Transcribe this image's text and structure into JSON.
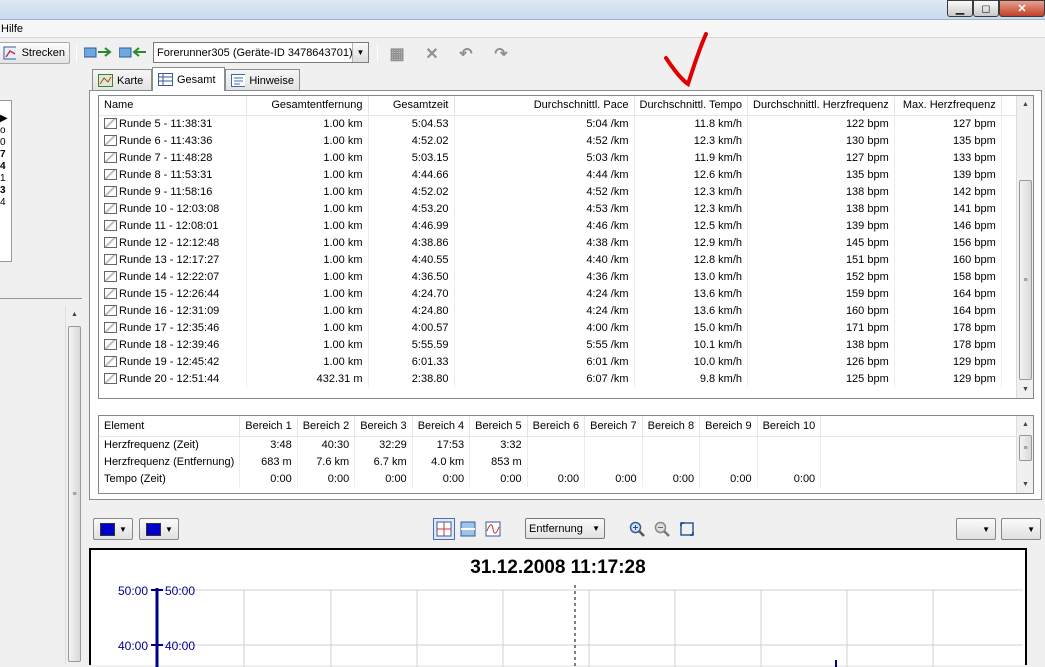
{
  "window": {
    "min": "▁",
    "max": "◻",
    "close": "✕"
  },
  "menu": {
    "help": "Hilfe"
  },
  "toolbar": {
    "routes_label": "Strecken",
    "device_select": "Forerunner305 (Geräte-ID 3478643701)"
  },
  "tabs": [
    {
      "label": "Karte"
    },
    {
      "label": "Gesamt"
    },
    {
      "label": "Hinweise"
    }
  ],
  "left_panel": {
    "fragments": [
      "▶",
      "o",
      "0",
      "7",
      "4",
      "1",
      "3",
      "4"
    ]
  },
  "laps": {
    "headers": [
      "Name",
      "Gesamtentfernung",
      "Gesamtzeit",
      "Durchschnittl. Pace",
      "Durchschnittl. Tempo",
      "Durchschnittl. Herzfrequenz",
      "Max. Herzfrequenz"
    ],
    "rows": [
      [
        "Runde 5 - 11:38:31",
        "1.00 km",
        "5:04.53",
        "5:04 /km",
        "11.8 km/h",
        "122 bpm",
        "127 bpm"
      ],
      [
        "Runde 6 - 11:43:36",
        "1.00 km",
        "4:52.02",
        "4:52 /km",
        "12.3 km/h",
        "130 bpm",
        "135 bpm"
      ],
      [
        "Runde 7 - 11:48:28",
        "1.00 km",
        "5:03.15",
        "5:03 /km",
        "11.9 km/h",
        "127 bpm",
        "133 bpm"
      ],
      [
        "Runde 8 - 11:53:31",
        "1.00 km",
        "4:44.66",
        "4:44 /km",
        "12.6 km/h",
        "135 bpm",
        "139 bpm"
      ],
      [
        "Runde 9 - 11:58:16",
        "1.00 km",
        "4:52.02",
        "4:52 /km",
        "12.3 km/h",
        "138 bpm",
        "142 bpm"
      ],
      [
        "Runde 10 - 12:03:08",
        "1.00 km",
        "4:53.20",
        "4:53 /km",
        "12.3 km/h",
        "138 bpm",
        "141 bpm"
      ],
      [
        "Runde 11 - 12:08:01",
        "1.00 km",
        "4:46.99",
        "4:46 /km",
        "12.5 km/h",
        "139 bpm",
        "146 bpm"
      ],
      [
        "Runde 12 - 12:12:48",
        "1.00 km",
        "4:38.86",
        "4:38 /km",
        "12.9 km/h",
        "145 bpm",
        "156 bpm"
      ],
      [
        "Runde 13 - 12:17:27",
        "1.00 km",
        "4:40.55",
        "4:40 /km",
        "12.8 km/h",
        "151 bpm",
        "160 bpm"
      ],
      [
        "Runde 14 - 12:22:07",
        "1.00 km",
        "4:36.50",
        "4:36 /km",
        "13.0 km/h",
        "152 bpm",
        "158 bpm"
      ],
      [
        "Runde 15 - 12:26:44",
        "1.00 km",
        "4:24.70",
        "4:24 /km",
        "13.6 km/h",
        "159 bpm",
        "164 bpm"
      ],
      [
        "Runde 16 - 12:31:09",
        "1.00 km",
        "4:24.80",
        "4:24 /km",
        "13.6 km/h",
        "160 bpm",
        "164 bpm"
      ],
      [
        "Runde 17 - 12:35:46",
        "1.00 km",
        "4:00.57",
        "4:00 /km",
        "15.0 km/h",
        "171 bpm",
        "178 bpm"
      ],
      [
        "Runde 18 - 12:39:46",
        "1.00 km",
        "5:55.59",
        "5:55 /km",
        "10.1 km/h",
        "138 bpm",
        "178 bpm"
      ],
      [
        "Runde 19 - 12:45:42",
        "1.00 km",
        "6:01.33",
        "6:01 /km",
        "10.0 km/h",
        "126 bpm",
        "129 bpm"
      ],
      [
        "Runde 20 - 12:51:44",
        "432.31 m",
        "2:38.80",
        "6:07 /km",
        "9.8 km/h",
        "125 bpm",
        "129 bpm"
      ]
    ]
  },
  "zones": {
    "headers": [
      "Element",
      "Bereich 1",
      "Bereich 2",
      "Bereich 3",
      "Bereich 4",
      "Bereich 5",
      "Bereich 6",
      "Bereich 7",
      "Bereich 8",
      "Bereich 9",
      "Bereich 10"
    ],
    "rows": [
      [
        "Herzfrequenz (Zeit)",
        "3:48",
        "40:30",
        "32:29",
        "17:53",
        "3:32",
        "",
        "",
        "",
        "",
        ""
      ],
      [
        "Herzfrequenz (Entfernung)",
        "683 m",
        "7.6 km",
        "6.7 km",
        "4.0 km",
        "853 m",
        "",
        "",
        "",
        "",
        ""
      ],
      [
        "Tempo (Zeit)",
        "0:00",
        "0:00",
        "0:00",
        "0:00",
        "0:00",
        "0:00",
        "0:00",
        "0:00",
        "0:00",
        "0:00"
      ]
    ]
  },
  "chart_toolbar": {
    "axis_select": "Entfernung"
  },
  "chart": {
    "title": "31.12.2008 11:17:28",
    "y_ticks_left": [
      "50:00",
      "40:00"
    ],
    "y_ticks_right": [
      "50:00",
      "40:00"
    ],
    "line_color": "#00008b"
  },
  "colors": {
    "accent_blue": "#0000cc",
    "annotation_red": "#e00000"
  }
}
